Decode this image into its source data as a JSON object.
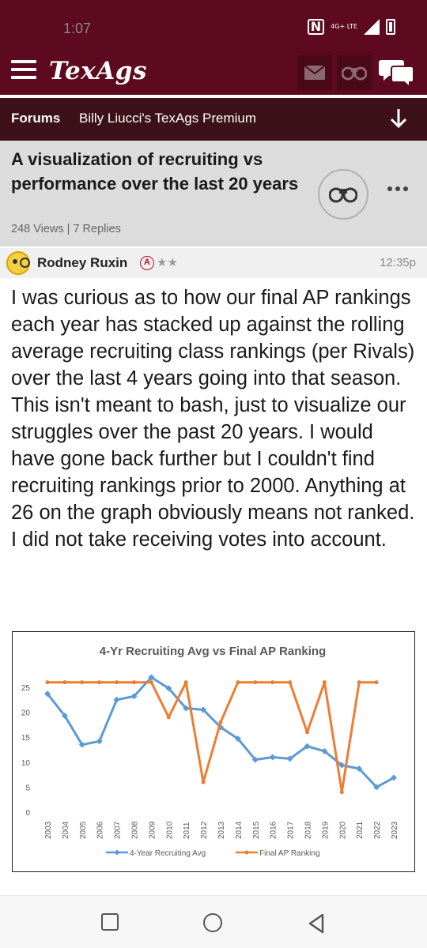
{
  "status_bar": {
    "time": "1:07",
    "network": "4G+ LTE"
  },
  "header": {
    "logo": "TexAgs"
  },
  "forum_bar": {
    "section": "Forums",
    "forum_name": "Billy Liucci's TexAgs Premium"
  },
  "thread": {
    "title": "A visualization of recruiting vs performance over the last 20 years",
    "meta": "248 Views | 7 Replies"
  },
  "post": {
    "author": "Rodney Ruxin",
    "badge": "A",
    "stars": "★★",
    "time": "12:35p",
    "body": "I was curious as to how our final AP rankings each year has stacked up against the rolling average recruiting class rankings (per Rivals) over the last 4 years going into that season. This isn't meant to bash, just to visualize our struggles over the past 20 years. I would have gone back further but I couldn't find recruiting rankings prior to 2000. Anything at 26 on the graph obviously means not ranked. I did not take receiving votes into account."
  },
  "chart_data": {
    "type": "line",
    "title": "4-Yr Recruiting Avg vs Final AP Ranking",
    "x": [
      "2003",
      "2004",
      "2005",
      "2006",
      "2007",
      "2008",
      "2009",
      "2010",
      "2011",
      "2012",
      "2013",
      "2014",
      "2015",
      "2016",
      "2017",
      "2018",
      "2019",
      "2020",
      "2021",
      "2022",
      "2023"
    ],
    "ylim": [
      0,
      25
    ],
    "yticks": [
      0,
      5,
      10,
      15,
      20,
      25
    ],
    "grid": false,
    "legend": "bottom",
    "series": [
      {
        "name": "4-Year Recruiting Avg",
        "color": "#5b9bd5",
        "values": [
          23.7,
          19.3,
          13.5,
          14.2,
          22.5,
          23.2,
          27.0,
          24.8,
          20.8,
          20.5,
          17.0,
          14.7,
          10.5,
          11.0,
          10.7,
          13.2,
          12.2,
          9.4,
          8.7,
          5.0,
          6.9
        ]
      },
      {
        "name": "Final AP Ranking",
        "color": "#ed7d31",
        "values": [
          26,
          26,
          26,
          26,
          26,
          26,
          26,
          19,
          26,
          6,
          18,
          26,
          26,
          26,
          26,
          16,
          26,
          4,
          26,
          26,
          null
        ]
      }
    ]
  }
}
